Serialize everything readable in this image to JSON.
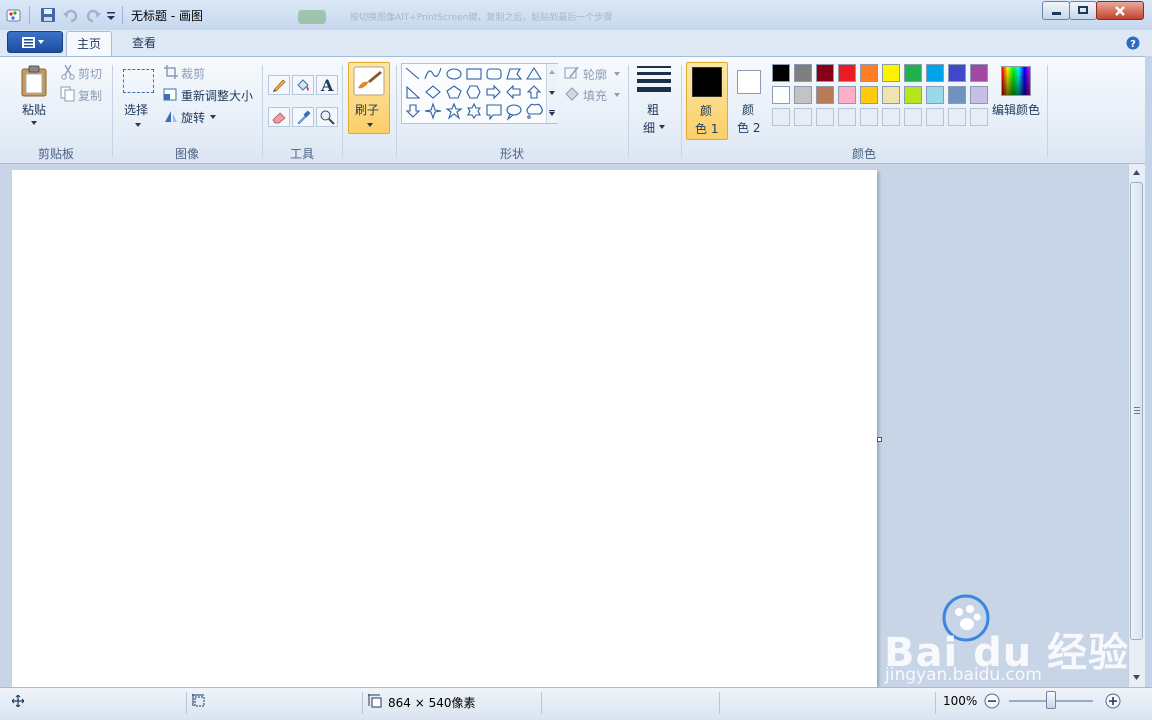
{
  "window": {
    "title": "无标题 - 画图"
  },
  "blurred_banner": "按切换图像AlT+PrintScreen键，复制之后，粘贴到最后一个步骤",
  "tabs": {
    "home": "主页",
    "view": "查看"
  },
  "clipboard": {
    "paste": "粘贴",
    "cut": "剪切",
    "copy": "复制",
    "group": "剪贴板"
  },
  "image": {
    "select": "选择",
    "crop": "裁剪",
    "resize": "重新调整大小",
    "rotate": "旋转",
    "group": "图像"
  },
  "tools": {
    "group": "工具",
    "text_glyph": "A"
  },
  "brushes": {
    "label": "刷子"
  },
  "shapes": {
    "outline": "轮廓",
    "fill": "填充",
    "group": "形状"
  },
  "size": {
    "line1": "粗",
    "line2": "细"
  },
  "colors": {
    "color1_line1": "颜",
    "color1_line2": "色 1",
    "color2_line1": "颜",
    "color2_line2": "色 2",
    "edit": "编辑颜色",
    "group": "颜色",
    "color1_value": "#000000",
    "color2_value": "#ffffff",
    "row1": [
      "#000000",
      "#7f7f7f",
      "#880015",
      "#ed1c24",
      "#ff7f27",
      "#fff200",
      "#22b14c",
      "#00a2e8",
      "#3f48cc",
      "#a349a4"
    ],
    "row2": [
      "#ffffff",
      "#c3c3c3",
      "#b97a57",
      "#ffaec9",
      "#ffc90e",
      "#efe4b0",
      "#b5e61d",
      "#99d9ea",
      "#7092be",
      "#c8bfe7"
    ]
  },
  "status": {
    "canvas_size": "864 × 540像素",
    "zoom": "100%"
  },
  "watermark": {
    "brand": "Bai du 经验",
    "url": "jingyan.baidu.com"
  }
}
